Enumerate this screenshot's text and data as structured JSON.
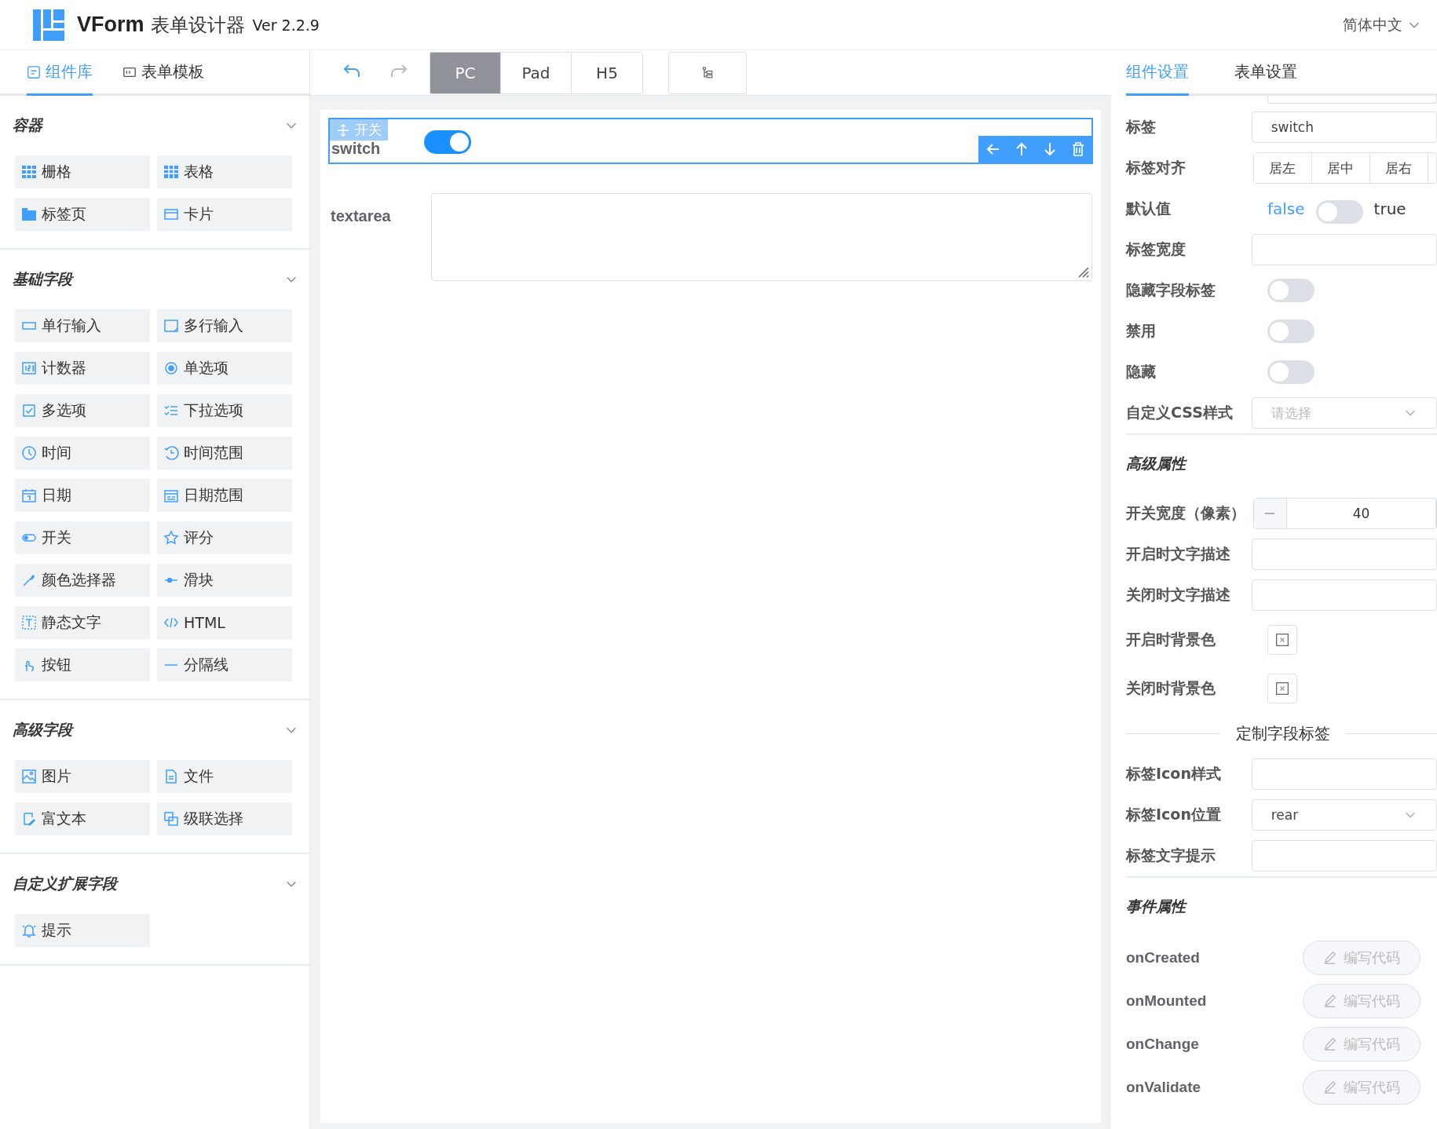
{
  "header": {
    "logo_text": "VForm",
    "title": "表单设计器",
    "version": "Ver 2.2.9",
    "language": "简体中文"
  },
  "left_tabs": [
    {
      "label": "组件库",
      "selected": true
    },
    {
      "label": "表单模板",
      "selected": false
    }
  ],
  "sections": [
    {
      "title": "容器",
      "expanded": true,
      "items": [
        "栅格",
        "表格",
        "标签页",
        "卡片"
      ]
    },
    {
      "title": "基础字段",
      "expanded": true,
      "items": [
        "单行输入",
        "多行输入",
        "计数器",
        "单选项",
        "多选项",
        "下拉选项",
        "时间",
        "时间范围",
        "日期",
        "日期范围",
        "开关",
        "评分",
        "颜色选择器",
        "滑块",
        "静态文字",
        "HTML",
        "按钮",
        "分隔线"
      ]
    },
    {
      "title": "高级字段",
      "expanded": true,
      "items": [
        "图片",
        "文件",
        "富文本",
        "级联选择"
      ]
    },
    {
      "title": "自定义扩展字段",
      "expanded": true,
      "items": [
        "提示"
      ]
    }
  ],
  "devices": [
    {
      "label": "PC",
      "selected": true
    },
    {
      "label": "Pad",
      "selected": false
    },
    {
      "label": "H5",
      "selected": false
    }
  ],
  "canvas": {
    "fields": [
      {
        "kind": "switch",
        "label": "switch",
        "tag": "开关",
        "on": true,
        "selected": true
      },
      {
        "kind": "textarea",
        "label": "textarea",
        "selected": false
      }
    ]
  },
  "right_tabs": [
    {
      "label": "组件设置",
      "selected": true
    },
    {
      "label": "表单设置",
      "selected": false
    }
  ],
  "settings": [
    {
      "kind": "partial"
    },
    {
      "kind": "input",
      "label": "标签",
      "value": "switch"
    },
    {
      "kind": "radio",
      "label": "标签对齐",
      "options": [
        {
          "label": "居左",
          "selected": false
        },
        {
          "label": "居中",
          "selected": false
        },
        {
          "label": "居右",
          "selected": false
        }
      ]
    },
    {
      "kind": "bool",
      "label": "默认值",
      "false_text": "false",
      "true_text": "true",
      "on": false
    },
    {
      "kind": "input",
      "label": "标签宽度"
    },
    {
      "kind": "switch",
      "label": "隐藏字段标签",
      "on": false
    },
    {
      "kind": "switch",
      "label": "禁用",
      "on": false
    },
    {
      "kind": "switch",
      "label": "隐藏",
      "on": false
    },
    {
      "kind": "select",
      "label": "自定义CSS样式",
      "placeholder": "请选择"
    },
    {
      "kind": "section",
      "label": "高级属性"
    },
    {
      "kind": "number",
      "label": "开关宽度（像素）",
      "value": "40"
    },
    {
      "kind": "input",
      "label": "开启时文字描述"
    },
    {
      "kind": "input",
      "label": "关闭时文字描述"
    },
    {
      "kind": "color",
      "label": "开启时背景色"
    },
    {
      "kind": "color",
      "label": "关闭时背景色"
    },
    {
      "kind": "divider",
      "label": "定制字段标签"
    },
    {
      "kind": "input",
      "label": "标签Icon样式"
    },
    {
      "kind": "select",
      "label": "标签Icon位置",
      "value": "rear"
    },
    {
      "kind": "input",
      "label": "标签文字提示"
    },
    {
      "kind": "section",
      "label": "事件属性"
    },
    {
      "kind": "event",
      "label": "onCreated",
      "button": "编写代码"
    },
    {
      "kind": "event",
      "label": "onMounted",
      "button": "编写代码"
    },
    {
      "kind": "event",
      "label": "onChange",
      "button": "编写代码"
    },
    {
      "kind": "event",
      "label": "onValidate",
      "button": "编写代码"
    }
  ]
}
